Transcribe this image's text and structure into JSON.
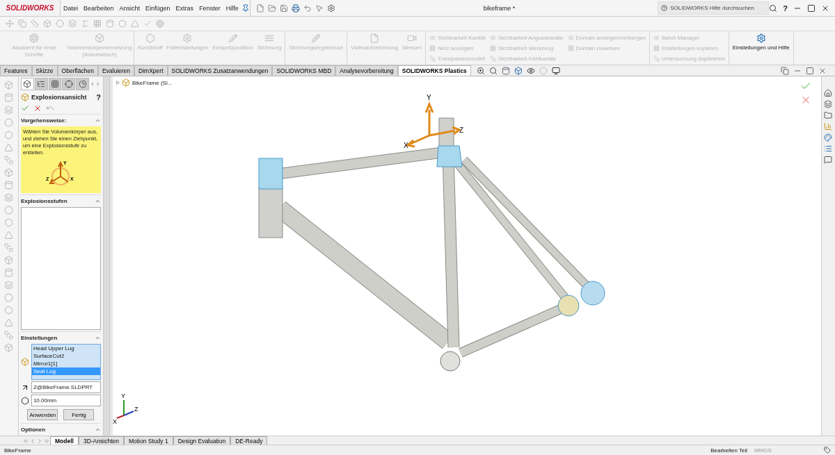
{
  "app": {
    "logo": "SOLIDWORKS"
  },
  "menu": [
    "Datei",
    "Bearbeiten",
    "Ansicht",
    "Einfügen",
    "Extras",
    "Fenster",
    "Hilfe"
  ],
  "window": {
    "title": "bikeframe *"
  },
  "search": {
    "placeholder": "SOLIDWORKS Hilfe durchsuchen"
  },
  "help_button": "?",
  "ribbon_groups": [
    {
      "kind": "large",
      "items": [
        {
          "label": "Assistent für erste Schritte",
          "disabled": true
        },
        {
          "label": "Volumenkörpervernetzung (Automatisch)",
          "disabled": true
        }
      ]
    },
    {
      "kind": "large",
      "items": [
        {
          "label": "Kunststoff",
          "disabled": true
        },
        {
          "label": "Fülleinstellungen",
          "disabled": true
        },
        {
          "label": "Einspritzposition",
          "disabled": true
        },
        {
          "label": "Strömung",
          "disabled": true
        }
      ]
    },
    {
      "kind": "large",
      "items": [
        {
          "label": "Strömungsergebnisse",
          "disabled": true
        }
      ]
    },
    {
      "kind": "large",
      "items": [
        {
          "label": "Videoaufzeichnung",
          "disabled": true
        },
        {
          "label": "Messen",
          "disabled": true
        }
      ]
    },
    {
      "kind": "small",
      "columns": [
        [
          {
            "label": "Sichtbarkeit Kavität",
            "disabled": true
          },
          {
            "label": "Netz anzeigen",
            "disabled": true
          },
          {
            "label": "Transparenzmodell",
            "disabled": true
          }
        ],
        [
          {
            "label": "Sichtbarkeit Angusskanäle",
            "disabled": true
          },
          {
            "label": "Sichtbarkeit Werkzeug",
            "disabled": true
          },
          {
            "label": "Sichtbarkeit Kühlkanäle",
            "disabled": true
          }
        ],
        [
          {
            "label": "Domain anzeigen/verbergen",
            "disabled": true
          },
          {
            "label": "Domain zuweisen",
            "disabled": true
          }
        ]
      ]
    },
    {
      "kind": "small",
      "columns": [
        [
          {
            "label": "Batch Manager",
            "disabled": true
          },
          {
            "label": "Einstellungen kopieren",
            "disabled": true
          },
          {
            "label": "Untersuchung duplizieren",
            "disabled": true
          }
        ]
      ]
    },
    {
      "kind": "large",
      "items": [
        {
          "label": "Einstellungen und Hilfe",
          "disabled": false
        }
      ]
    }
  ],
  "command_tabs": [
    {
      "label": "Features",
      "selected": false
    },
    {
      "label": "Skizze",
      "selected": false
    },
    {
      "label": "Oberflächen",
      "selected": false
    },
    {
      "label": "Evaluieren",
      "selected": false
    },
    {
      "label": "DimXpert",
      "selected": false
    },
    {
      "label": "SOLIDWORKS Zusatzanwendungen",
      "selected": false
    },
    {
      "label": "SOLIDWORKS MBD",
      "selected": false
    },
    {
      "label": "Analysevorbereitung",
      "selected": false
    },
    {
      "label": "SOLIDWORKS Plastics",
      "selected": true
    }
  ],
  "pm_tabs": [
    {
      "selected": true
    },
    {
      "selected": false
    },
    {
      "selected": false
    },
    {
      "selected": false
    },
    {
      "selected": false
    }
  ],
  "property_manager": {
    "title": "Explosionsansicht",
    "help": "?",
    "procedure": {
      "title": "Vorgehensweise:",
      "message": "Wählen Sie Volumenkörper aus, und ziehen Sie einen Ziehpunkt, um eine Explosionsstufe zu erstellen.",
      "axes": {
        "x": "X",
        "y": "Y",
        "z": "Z"
      }
    },
    "steps": {
      "title": "Explosionsstufen"
    },
    "settings": {
      "title": "Einstellungen",
      "bodies": [
        {
          "label": "Head Upper Lug",
          "selected": false
        },
        {
          "label": "SurfaceCut2",
          "selected": false
        },
        {
          "label": "Mirror1[1]",
          "selected": false
        },
        {
          "label": "Seat Lug",
          "selected": true
        }
      ],
      "direction": {
        "value": "Z@BikeFrame.SLDPRT"
      },
      "distance": {
        "value": "10.00mm"
      },
      "buttons": [
        "Anwenden",
        "Fertig"
      ]
    },
    "options": {
      "title": "Optionen"
    }
  },
  "tree": {
    "root": "BikeFrame  (Si..."
  },
  "triad": {
    "x": "X",
    "y": "Y",
    "z": "Z"
  },
  "mini_triad": {
    "x": "X",
    "y": "Y",
    "z": "Z"
  },
  "bottom_tabs": [
    {
      "label": "Modell",
      "selected": true
    },
    {
      "label": "3D-Ansichten",
      "selected": false
    },
    {
      "label": "Motion Study 1",
      "selected": false
    },
    {
      "label": "Design Evaluation",
      "selected": false
    },
    {
      "label": "DE-Ready",
      "selected": false
    }
  ],
  "status_bar": {
    "document": "BikeFrame",
    "mode": "Bearbeiten Teil",
    "units": "MMGS"
  }
}
